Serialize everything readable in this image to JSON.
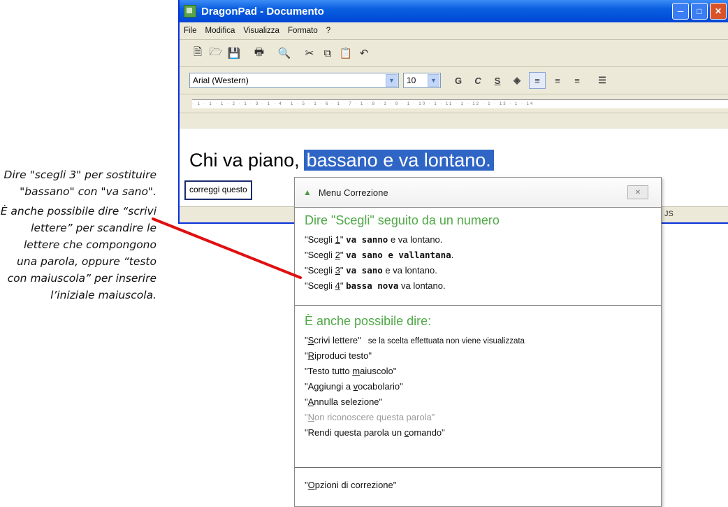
{
  "annotation": {
    "para1": "Dire \"scegli 3\" per sostituire \"bassano\" con \"va sano\".",
    "para2": "È anche possibile dire “scrivi lettere” per scandire le lettere che compongono una parola, oppure “testo con maiuscola” per inserire l’iniziale maiuscola."
  },
  "window": {
    "title": "DragonPad - Documento",
    "menu": [
      "File",
      "Modifica",
      "Visualizza",
      "Formato",
      "?"
    ],
    "font_name": "Arial (Western)",
    "font_size": "10",
    "format_buttons": [
      "G",
      "C",
      "S"
    ],
    "doc_text_plain": "Chi va piano,",
    "doc_text_selected": "bassano e va lontano.",
    "status_fragment": "JS"
  },
  "correction_box": {
    "label": "correggi questo"
  },
  "popup": {
    "title": "Menu Correzione",
    "section1_heading": "Dire \"Scegli\" seguito da un numero",
    "choices": [
      {
        "cmd_pre": "\"Scegli ",
        "num": "1",
        "cmd_post": "\" ",
        "bold": "va sanno",
        "rest": " e va lontano."
      },
      {
        "cmd_pre": "\"Scegli ",
        "num": "2",
        "cmd_post": "\" ",
        "bold": "va sano e vallantana",
        "rest": "."
      },
      {
        "cmd_pre": "\"Scegli ",
        "num": "3",
        "cmd_post": "\" ",
        "bold": "va sano",
        "rest": " e va lontano."
      },
      {
        "cmd_pre": "\"Scegli ",
        "num": "4",
        "cmd_post": "\" ",
        "bold": "bassa nova",
        "rest": " va lontano."
      }
    ],
    "section2_heading": "È anche possibile dire:",
    "commands": [
      {
        "pre": "\"",
        "u": "S",
        "post": "crivi lettere\"",
        "note": "se la scelta effettuata non viene visualizzata",
        "disabled": false
      },
      {
        "pre": "\"",
        "u": "R",
        "post": "iproduci testo\"",
        "note": "",
        "disabled": false
      },
      {
        "pre": "\"Testo tutto ",
        "u": "m",
        "post": "aiuscolo\"",
        "note": "",
        "disabled": false
      },
      {
        "pre": "\"Aggiungi a ",
        "u": "v",
        "post": "ocabolario\"",
        "note": "",
        "disabled": false
      },
      {
        "pre": "\"",
        "u": "A",
        "post": "nnulla selezione\"",
        "note": "",
        "disabled": false
      },
      {
        "pre": "\"",
        "u": "N",
        "post": "on riconoscere questa parola\"",
        "note": "",
        "disabled": true
      },
      {
        "pre": "\"Rendi questa parola un ",
        "u": "c",
        "post": "omando\"",
        "note": "",
        "disabled": false
      }
    ],
    "options": {
      "pre": "\"",
      "u": "O",
      "post": "pzioni di correzione\""
    }
  },
  "colors": {
    "title_blue": "#0a5fe0",
    "selection": "#2f66c6",
    "popup_heading": "#4fa846",
    "pointer": "#e01010"
  }
}
